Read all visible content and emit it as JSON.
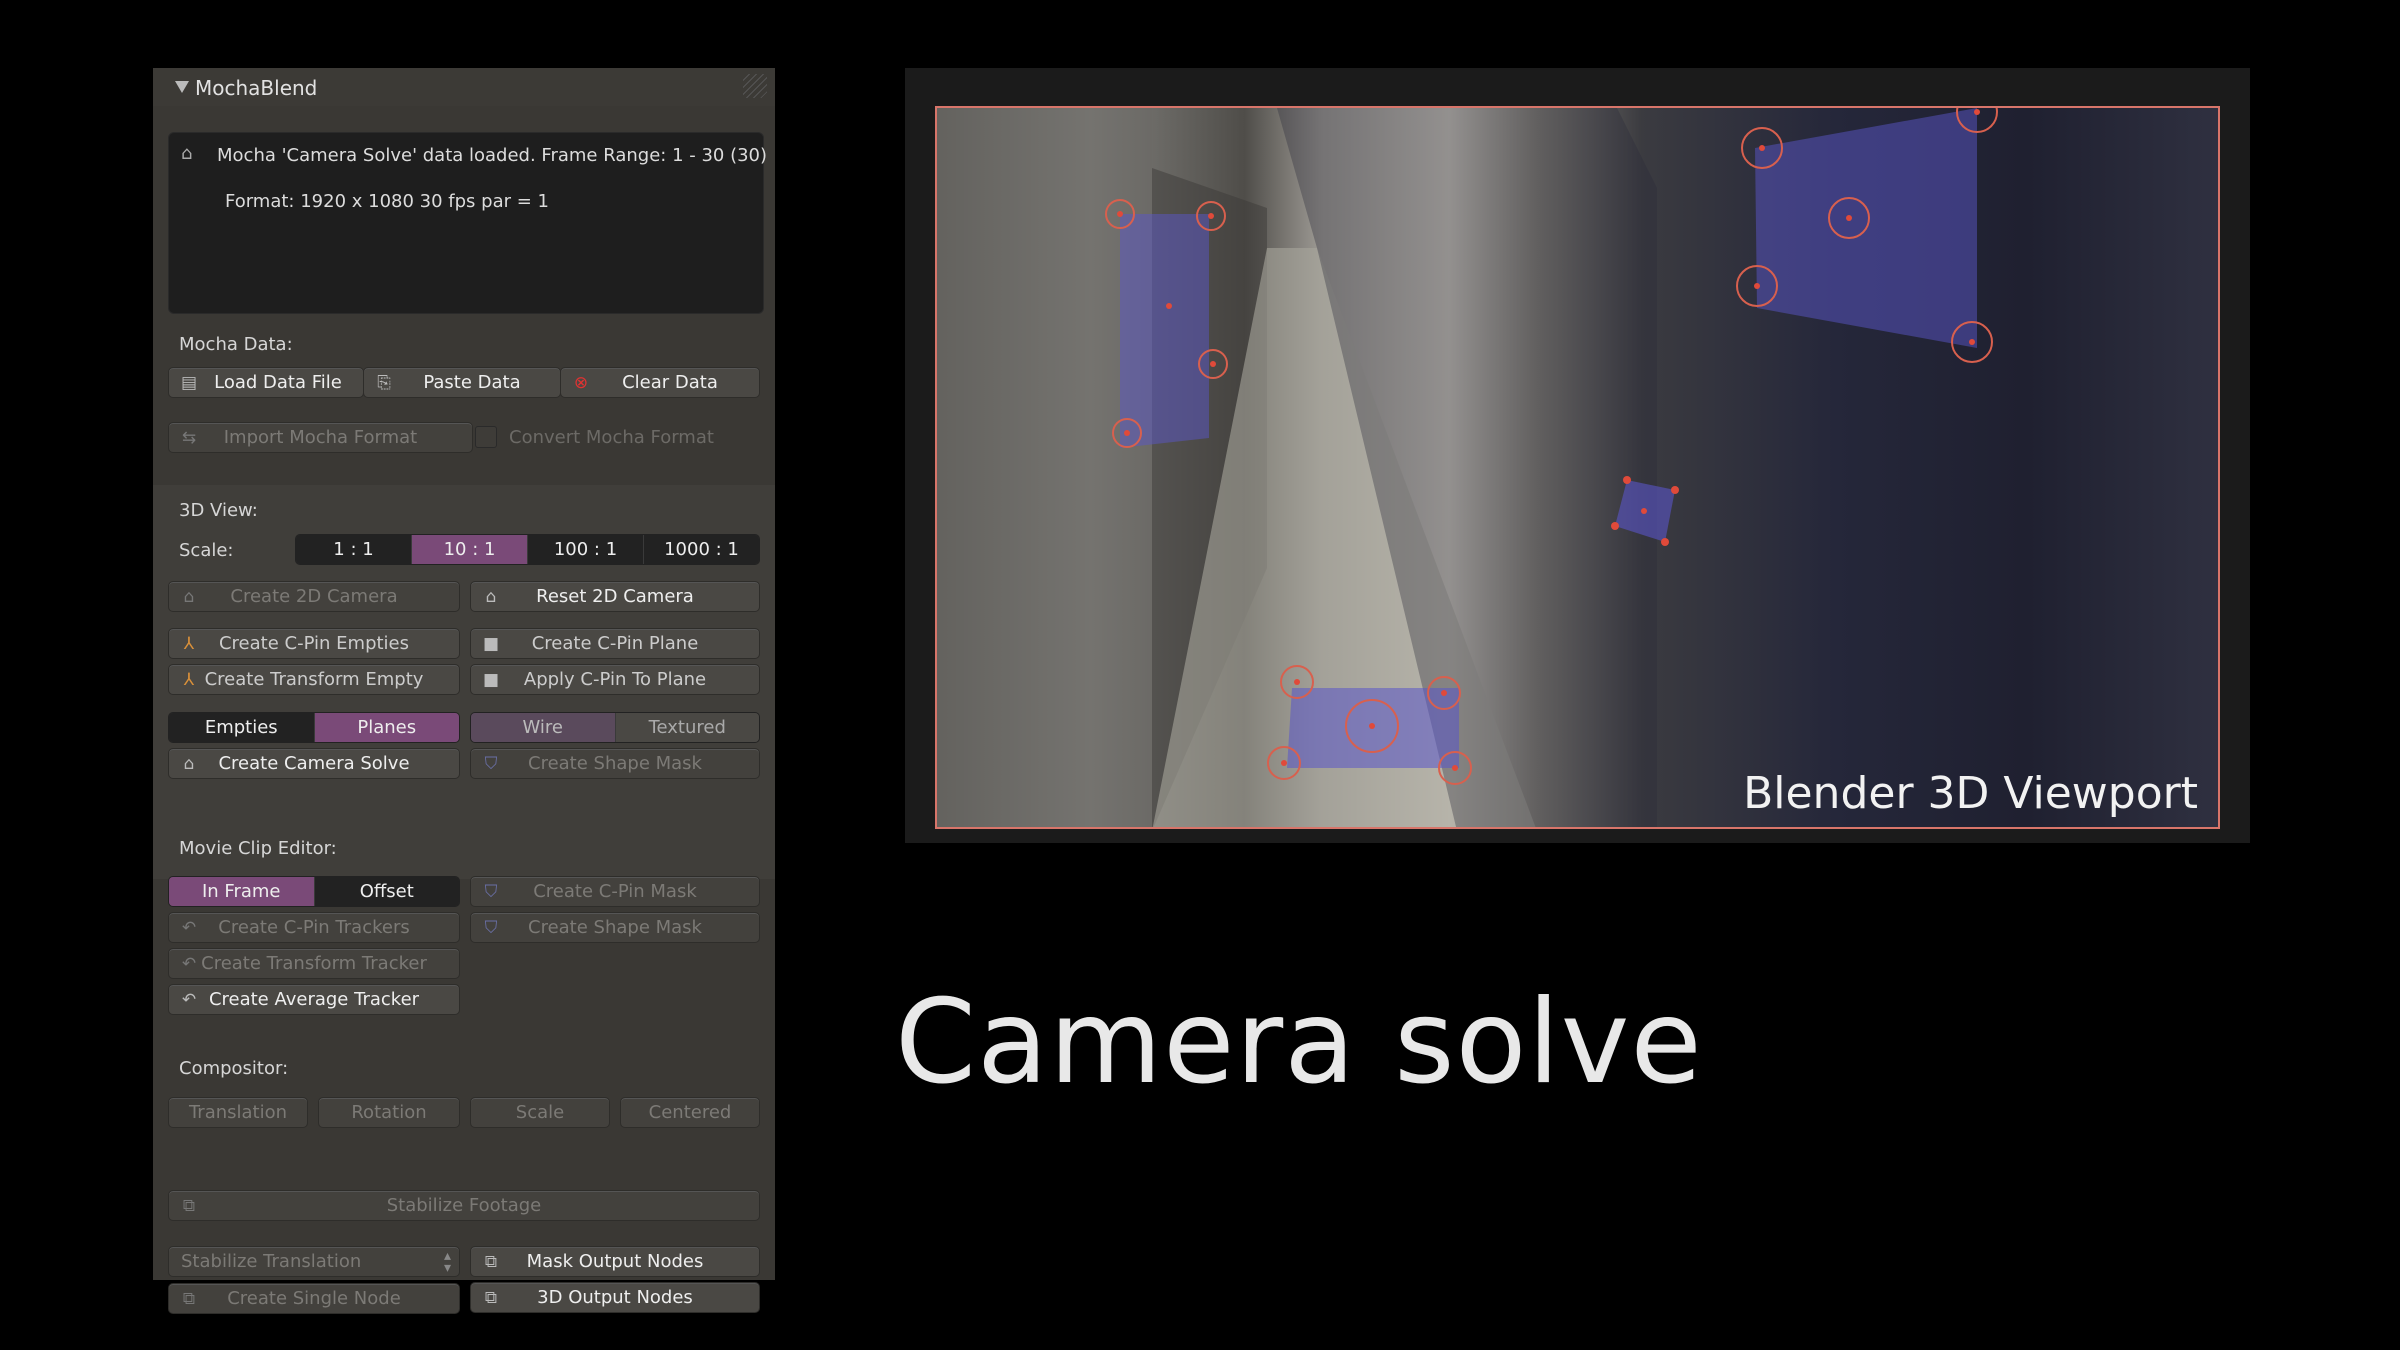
{
  "panel": {
    "title": "MochaBlend",
    "info": {
      "line1": "Mocha 'Camera Solve' data loaded.   Frame Range: 1 - 30  (30)",
      "line2": "Format:  1920 x 1080    30 fps    par = 1"
    },
    "mocha_data": {
      "label": "Mocha Data:",
      "load": "Load Data File",
      "paste": "Paste Data",
      "clear": "Clear Data",
      "import": "Import Mocha Format",
      "convert": "Convert Mocha Format"
    },
    "view3d": {
      "label": "3D View:",
      "scale_label": "Scale:",
      "scales": [
        "1 : 1",
        "10 : 1",
        "100 : 1",
        "1000 : 1"
      ],
      "scale_selected": "10 : 1",
      "create_2d_camera": "Create 2D Camera",
      "reset_2d_camera": "Reset 2D Camera",
      "create_cpin_empties": "Create C-Pin Empties",
      "create_cpin_plane": "Create C-Pin Plane",
      "create_transform_empty": "Create Transform Empty",
      "apply_cpin_to_plane": "Apply C-Pin To Plane",
      "toggle_a": [
        "Empties",
        "Planes"
      ],
      "toggle_a_selected": "Planes",
      "toggle_b": [
        "Wire",
        "Textured"
      ],
      "toggle_b_selected": "Wire",
      "create_camera_solve": "Create Camera Solve",
      "create_shape_mask": "Create Shape Mask"
    },
    "movie_clip": {
      "label": "Movie Clip Editor:",
      "toggle": [
        "In Frame",
        "Offset"
      ],
      "toggle_selected": "In Frame",
      "create_cpin_mask": "Create C-Pin Mask",
      "create_cpin_trackers": "Create C-Pin Trackers",
      "create_shape_mask": "Create Shape Mask",
      "create_transform_tracker": "Create Transform Tracker",
      "create_average_tracker": "Create Average Tracker"
    },
    "compositor": {
      "label": "Compositor:",
      "translation": "Translation",
      "rotation": "Rotation",
      "scale": "Scale",
      "centered": "Centered",
      "stabilize_footage": "Stabilize Footage",
      "stabilize_select": "Stabilize Translation",
      "mask_output_nodes": "Mask Output Nodes",
      "create_single_node": "Create Single Node",
      "output_3d_nodes": "3D Output Nodes"
    }
  },
  "viewport": {
    "label": "Blender 3D Viewport"
  },
  "caption": "Camera solve",
  "colors": {
    "accent": "#7a4a78",
    "viewport_border": "#d8756a",
    "plane_fill": "#5a55c8"
  }
}
